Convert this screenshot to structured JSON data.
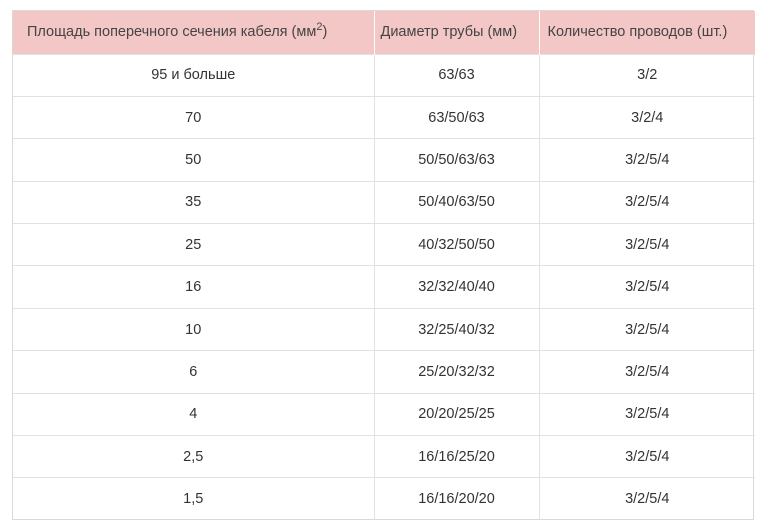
{
  "table": {
    "headers": [
      {
        "text": "Площадь поперечного сечения кабеля (мм",
        "sup": "2",
        "suffix": ")"
      },
      {
        "text": "Диаметр трубы (мм)"
      },
      {
        "text": "Количество проводов (шт.)"
      }
    ],
    "rows": [
      [
        "95 и больше",
        "63/63",
        "3/2"
      ],
      [
        "70",
        "63/50/63",
        "3/2/4"
      ],
      [
        "50",
        "50/50/63/63",
        "3/2/5/4"
      ],
      [
        "35",
        "50/40/63/50",
        "3/2/5/4"
      ],
      [
        "25",
        "40/32/50/50",
        "3/2/5/4"
      ],
      [
        "16",
        "32/32/40/40",
        "3/2/5/4"
      ],
      [
        "10",
        "32/25/40/32",
        "3/2/5/4"
      ],
      [
        "6",
        "25/20/32/32",
        "3/2/5/4"
      ],
      [
        "4",
        "20/20/25/25",
        "3/2/5/4"
      ],
      [
        "2,5",
        "16/16/25/20",
        "3/2/5/4"
      ],
      [
        "1,5",
        "16/16/20/20",
        "3/2/5/4"
      ]
    ]
  },
  "colors": {
    "header_bg": "#f4c7c7",
    "grid_line": "#e2e2e2",
    "text": "#333333"
  }
}
